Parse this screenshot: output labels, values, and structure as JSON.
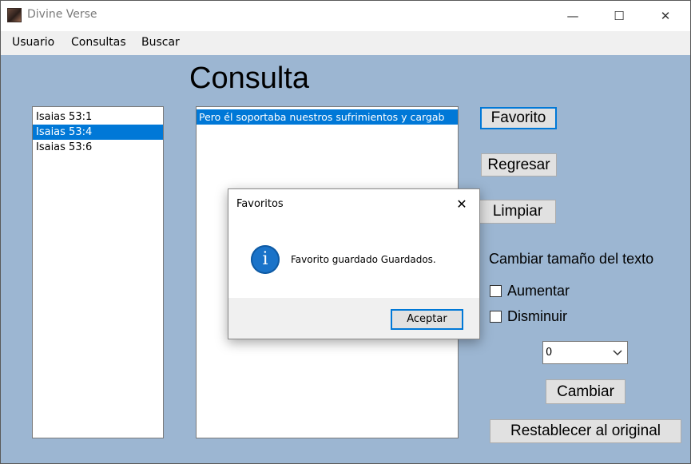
{
  "window": {
    "title": "Divine Verse",
    "minimize_glyph": "—",
    "maximize_glyph": "☐",
    "close_glyph": "✕"
  },
  "menu": {
    "items": [
      "Usuario",
      "Consultas",
      "Buscar"
    ]
  },
  "main": {
    "heading": "Consulta",
    "verses": [
      "Isaias 53:1",
      "Isaias 53:4",
      "Isaias 53:6"
    ],
    "selected_verse_index": 1,
    "text_lines": [
      "Pero él soportaba nuestros sufrimientos y cargab"
    ],
    "buttons": {
      "favorito": "Favorito",
      "regresar": "Regresar",
      "limpiar": "Limpiar",
      "cambiar": "Cambiar",
      "restablecer": "Restablecer al original"
    },
    "text_size_label": "Cambiar tamaño del texto",
    "aumentar_label": "Aumentar",
    "disminuir_label": "Disminuir",
    "aumentar_checked": false,
    "disminuir_checked": false,
    "size_value": "0"
  },
  "dialog": {
    "title": "Favoritos",
    "close_glyph": "✕",
    "icon": "info-icon",
    "icon_glyph": "i",
    "message": "Favorito guardado Guardados.",
    "ok_label": "Aceptar"
  },
  "colors": {
    "client_background": "#9cb6d2",
    "selection": "#0078d7",
    "info_icon": "#1a73c9"
  }
}
